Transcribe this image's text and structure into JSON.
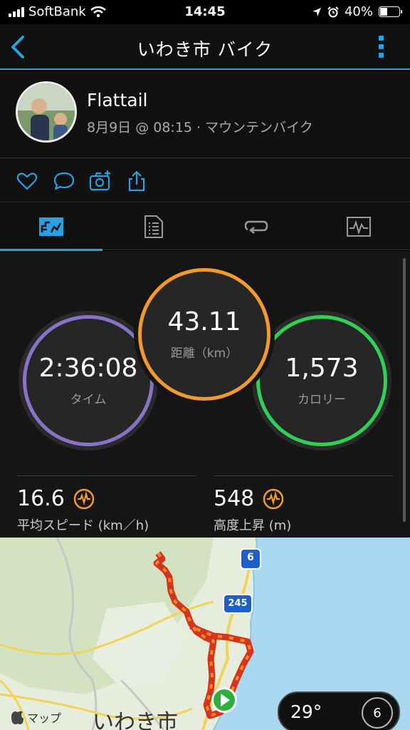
{
  "status": {
    "carrier": "SoftBank",
    "time": "14:45",
    "battery": "40%"
  },
  "nav": {
    "title": "いわき市 バイク"
  },
  "profile": {
    "name": "Flattail",
    "meta": "8月9日 @ 08:15 · マウンテンバイク"
  },
  "stats": {
    "time": {
      "value": "2:36:08",
      "label": "タイム",
      "color": "#8a72c8"
    },
    "distance": {
      "value": "43.11",
      "label": "距離（km）",
      "color": "#f39a2b"
    },
    "calories": {
      "value": "1,573",
      "label": "カロリー",
      "color": "#2fd155"
    },
    "speed": {
      "value": "16.6",
      "label": "平均スピード (km／h)"
    },
    "ascent": {
      "value": "548",
      "label": "高度上昇 (m)"
    }
  },
  "map": {
    "attribution": "マップ",
    "city": "いわき市",
    "route6": "6",
    "route245": "245",
    "temperature": "29°",
    "wind": "6"
  },
  "colors": {
    "accent": "#2aa0e0",
    "badge": "#f39a2b"
  }
}
